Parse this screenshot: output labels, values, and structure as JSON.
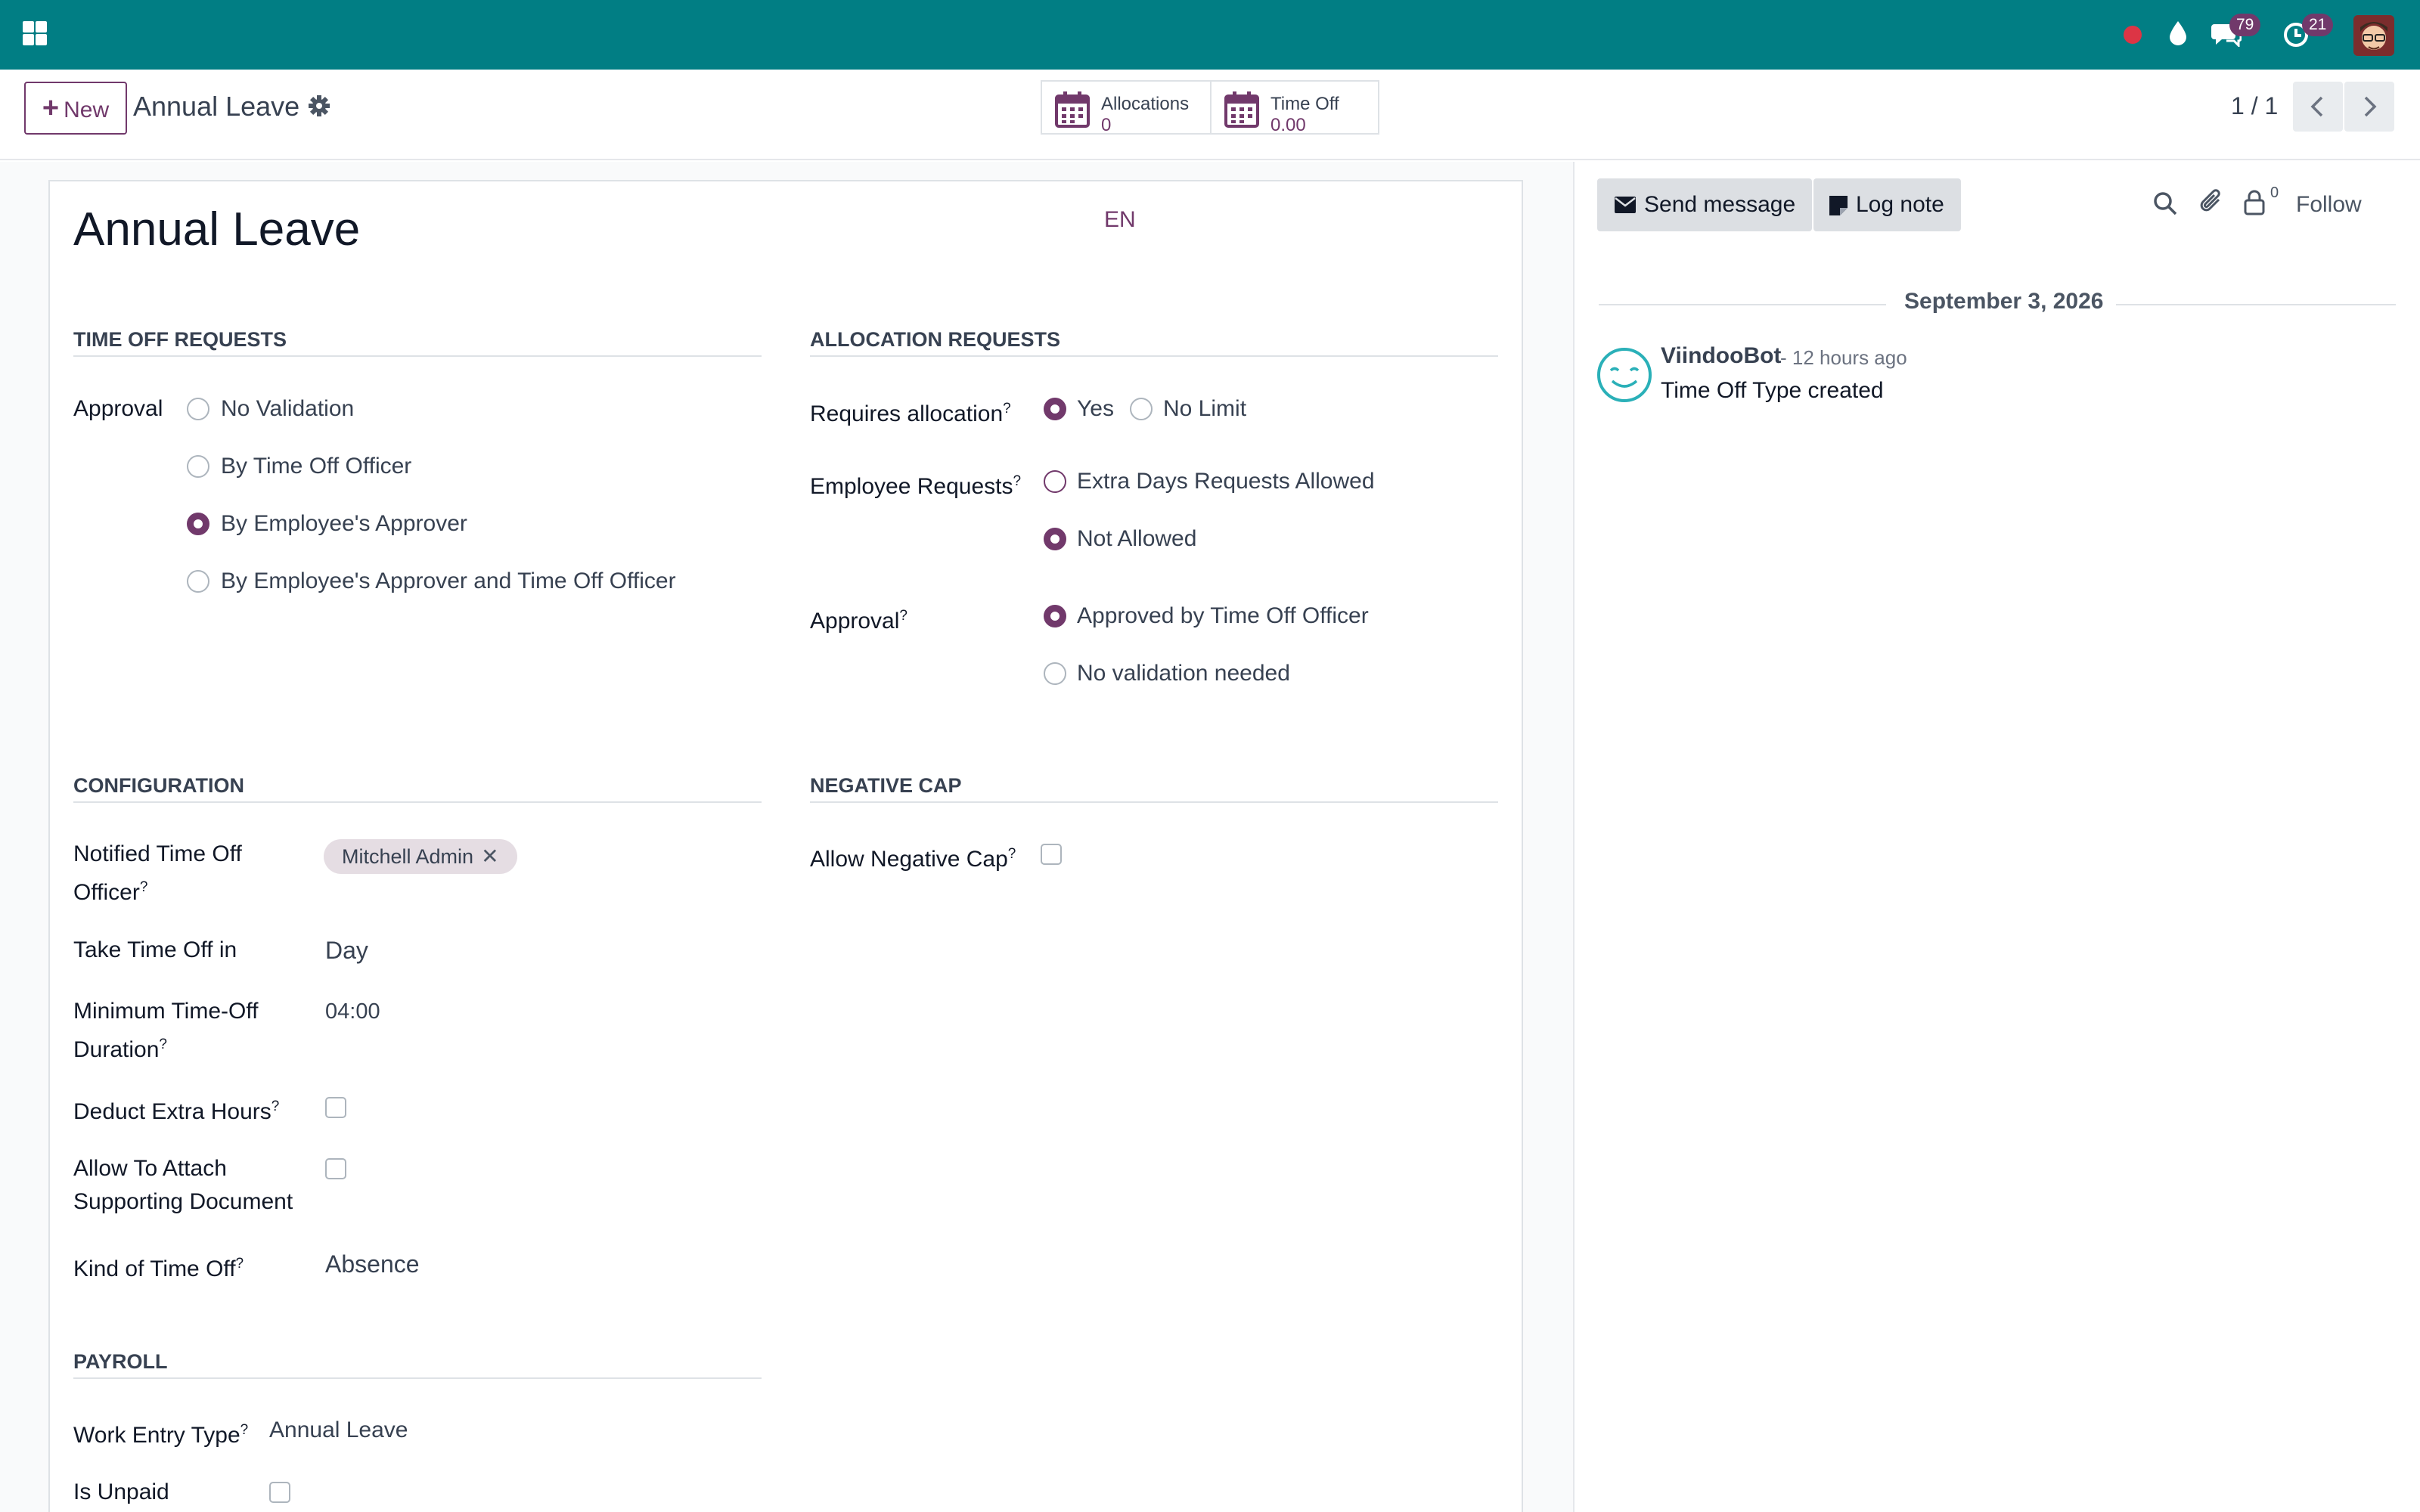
{
  "navbar": {
    "icons": [
      "apps-icon",
      "status-dot-icon",
      "droplet-icon",
      "chat-icon",
      "clock-icon",
      "avatar"
    ],
    "messages_badge": "79",
    "activities_badge": "21",
    "colors": {
      "bar": "#017e84",
      "badge": "#71396b",
      "status_dot": "#dc3545"
    }
  },
  "control_panel": {
    "new_label": "New",
    "breadcrumb": "Annual Leave",
    "smart_buttons": [
      {
        "label": "Allocations",
        "value": "0",
        "icon": "calendar-icon"
      },
      {
        "label": "Time Off",
        "value": "0.00",
        "icon": "calendar-icon"
      }
    ],
    "pager": "1 / 1"
  },
  "form": {
    "title": "Annual Leave",
    "lang": "EN",
    "time_off_requests": {
      "section": "TIME OFF REQUESTS",
      "approval_label": "Approval",
      "options": [
        "No Validation",
        "By Time Off Officer",
        "By Employee's Approver",
        "By Employee's Approver and Time Off Officer"
      ],
      "selected": "By Employee's Approver"
    },
    "allocation_requests": {
      "section": "ALLOCATION REQUESTS",
      "requires_allocation_label": "Requires allocation",
      "requires_allocation_options": [
        "Yes",
        "No Limit"
      ],
      "requires_allocation_selected": "Yes",
      "employee_requests_label": "Employee Requests",
      "employee_requests_options": [
        "Extra Days Requests Allowed",
        "Not Allowed"
      ],
      "employee_requests_selected": "Not Allowed",
      "approval_label": "Approval",
      "approval_options": [
        "Approved by Time Off Officer",
        "No validation needed"
      ],
      "approval_selected": "Approved by Time Off Officer"
    },
    "configuration": {
      "section": "CONFIGURATION",
      "notified_label_1": "Notified Time Off",
      "notified_label_2": "Officer",
      "notified_tag": "Mitchell Admin",
      "take_time_off_label": "Take Time Off in",
      "take_time_off_value": "Day",
      "min_duration_label_1": "Minimum Time-Off",
      "min_duration_label_2": "Duration",
      "min_duration_value": "04:00",
      "deduct_label": "Deduct Extra Hours",
      "deduct_checked": false,
      "attach_label_1": "Allow To Attach",
      "attach_label_2": "Supporting Document",
      "attach_checked": false,
      "kind_label": "Kind of Time Off",
      "kind_value": "Absence"
    },
    "negative_cap": {
      "section": "NEGATIVE CAP",
      "allow_label": "Allow Negative Cap",
      "allow_checked": false
    },
    "payroll": {
      "section": "PAYROLL",
      "work_entry_label": "Work Entry Type",
      "work_entry_value": "Annual Leave",
      "unpaid_label": "Is Unpaid",
      "unpaid_checked": false
    },
    "help_mark": "?"
  },
  "chatter": {
    "send_message": "Send message",
    "log_note": "Log note",
    "followers_count": "0",
    "follow": "Follow",
    "date": "September 3, 2026",
    "message": {
      "author": "ViindooBot",
      "time": "- 12 hours ago",
      "body": "Time Off Type created"
    }
  }
}
